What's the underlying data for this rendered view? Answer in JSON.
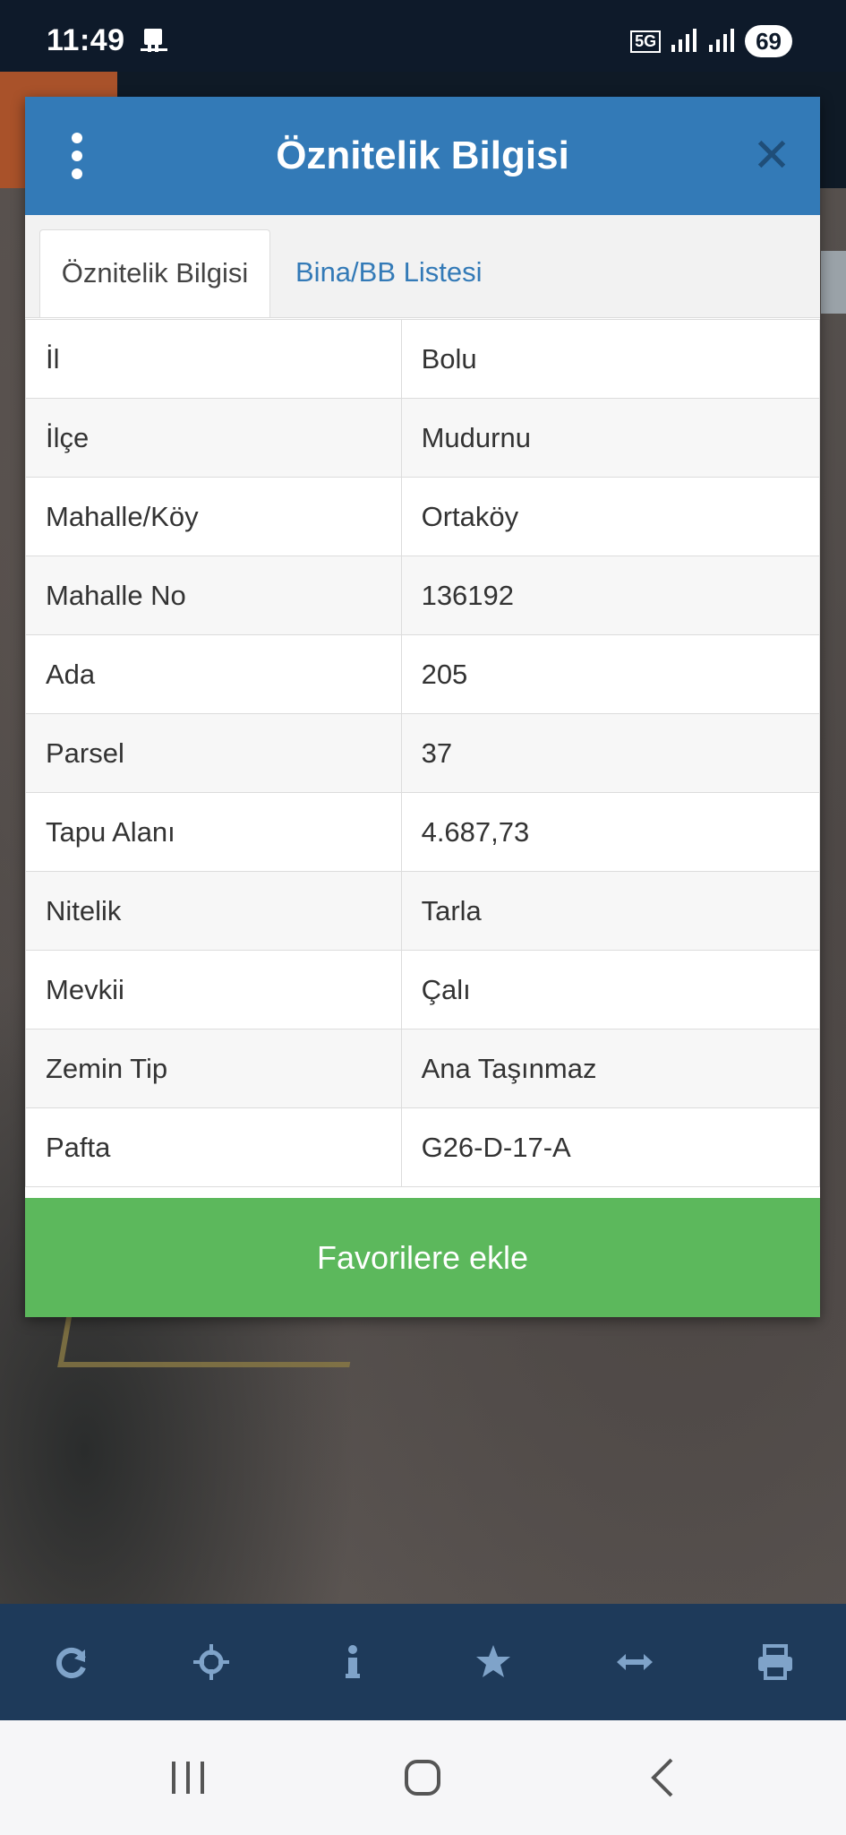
{
  "status_bar": {
    "time": "11:49",
    "network": "5G",
    "battery": "69"
  },
  "dialog": {
    "title": "Öznitelik Bilgisi",
    "tabs": [
      {
        "label": "Öznitelik Bilgisi",
        "active": true
      },
      {
        "label": "Bina/BB Listesi",
        "active": false
      }
    ],
    "rows": [
      {
        "key": "İl",
        "value": "Bolu"
      },
      {
        "key": "İlçe",
        "value": "Mudurnu"
      },
      {
        "key": "Mahalle/Köy",
        "value": "Ortaköy"
      },
      {
        "key": "Mahalle No",
        "value": "136192"
      },
      {
        "key": "Ada",
        "value": "205"
      },
      {
        "key": "Parsel",
        "value": "37"
      },
      {
        "key": "Tapu Alanı",
        "value": "4.687,73"
      },
      {
        "key": "Nitelik",
        "value": "Tarla"
      },
      {
        "key": "Mevkii",
        "value": "Çalı"
      },
      {
        "key": "Zemin Tip",
        "value": "Ana Taşınmaz"
      },
      {
        "key": "Pafta",
        "value": "G26-D-17-A"
      }
    ],
    "favorite_button": "Favorilere ekle"
  },
  "toolbar": {
    "icons": [
      "refresh-icon",
      "crosshair-icon",
      "info-icon",
      "star-icon",
      "measure-icon",
      "print-icon"
    ]
  },
  "colors": {
    "header": "#337ab7",
    "button": "#5cb85c",
    "toolbar": "#1e3a5a"
  }
}
